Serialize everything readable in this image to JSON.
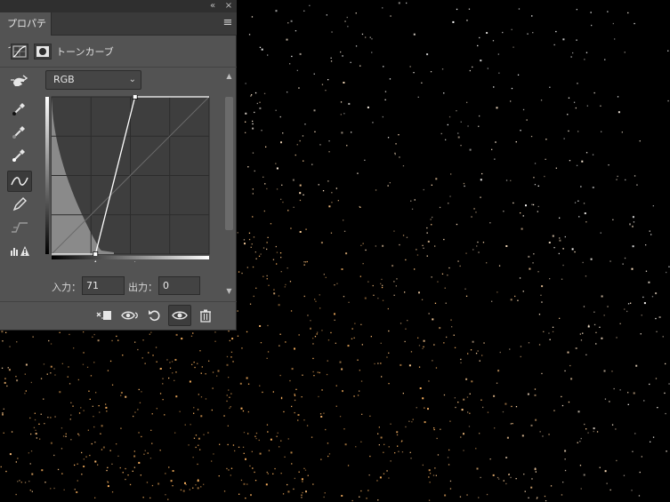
{
  "window": {
    "collapse_glyph": "«",
    "close_glyph": "×",
    "menu_glyph": "≡"
  },
  "panel": {
    "tab_label": "プロパティ",
    "adjustment_title": "トーンカーブ",
    "header_icons": [
      "curves-adjustment-icon",
      "layer-mask-icon"
    ]
  },
  "tools": [
    "target-adjust-hand-icon",
    "black-point-eyedropper-icon",
    "gray-point-eyedropper-icon",
    "white-point-eyedropper-icon",
    "curve-edit-points-icon",
    "pencil-draw-icon",
    "smooth-curve-icon",
    "clipping-warning-icon"
  ],
  "active_tool": "curve-edit-points-icon",
  "channel": {
    "selected": "RGB"
  },
  "curve": {
    "points": [
      [
        71,
        0
      ],
      [
        135,
        255
      ]
    ],
    "input_range": [
      0,
      255
    ],
    "output_range": [
      0,
      255
    ],
    "black_slider": 71,
    "white_slider": 135
  },
  "io": {
    "input_label": "入力：",
    "input_value": "71",
    "output_label": "出力：",
    "output_value": "0"
  },
  "bottom_buttons": [
    "clip-to-layer-icon",
    "view-previous-state-icon",
    "reset-adjustment-icon",
    "toggle-visibility-icon",
    "delete-adjustment-icon"
  ],
  "active_bottom_button": "toggle-visibility-icon",
  "colors": {
    "panel_bg": "#535353",
    "dark_bg": "#000000",
    "particle_gold": "#f0c070",
    "particle_white": "#ffffff"
  }
}
